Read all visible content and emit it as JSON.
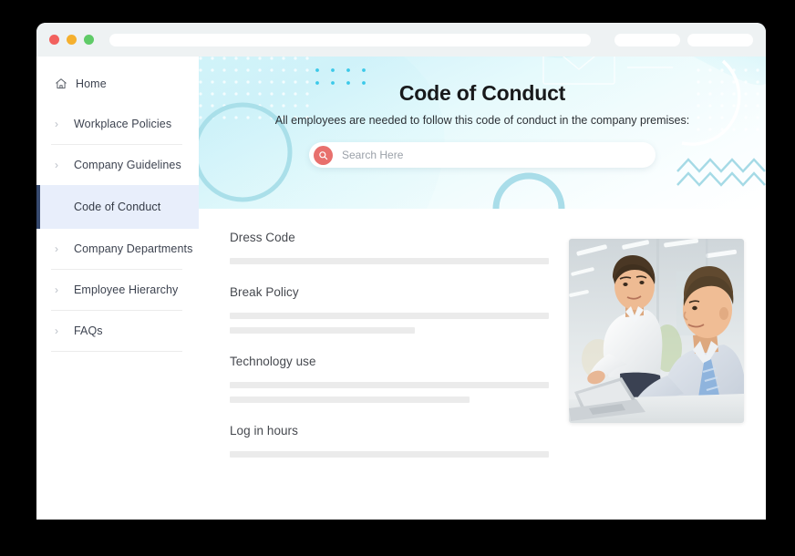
{
  "browser": {
    "traffic_lights": [
      "close",
      "minimize",
      "maximize"
    ],
    "address_bar_value": "",
    "tab_placeholders": 2
  },
  "sidebar": {
    "items": [
      {
        "label": "Home",
        "icon": "home-icon",
        "expandable": false,
        "active": false,
        "divider_after": false
      },
      {
        "label": "Workplace Policies",
        "icon": "chevron-right-icon",
        "expandable": true,
        "active": false,
        "divider_after": true
      },
      {
        "label": "Company Guidelines",
        "icon": "chevron-right-icon",
        "expandable": true,
        "active": false,
        "divider_after": false
      },
      {
        "label": "Code of Conduct",
        "icon": "",
        "expandable": false,
        "active": true,
        "divider_after": false
      },
      {
        "label": "Company Departments",
        "icon": "chevron-right-icon",
        "expandable": true,
        "active": false,
        "divider_after": true
      },
      {
        "label": "Employee Hierarchy",
        "icon": "chevron-right-icon",
        "expandable": true,
        "active": false,
        "divider_after": true
      },
      {
        "label": "FAQs",
        "icon": "chevron-right-icon",
        "expandable": true,
        "active": false,
        "divider_after": true
      }
    ]
  },
  "hero": {
    "title": "Code of Conduct",
    "subtitle": "All employees are needed to follow this code of conduct in the company premises:",
    "search": {
      "placeholder": "Search Here",
      "value": "",
      "icon": "search-icon",
      "icon_color": "#e8706d"
    }
  },
  "content": {
    "sections": [
      {
        "title": "Dress Code",
        "bars": [
          100
        ]
      },
      {
        "title": "Break Policy",
        "bars": [
          100,
          58
        ]
      },
      {
        "title": "Technology use",
        "bars": [
          100,
          75
        ]
      },
      {
        "title": "Log in hours",
        "bars": [
          100
        ]
      }
    ],
    "image": {
      "alt": "Two businessmen discussing over a laptop in an office",
      "name": "office-discussion-photo"
    }
  },
  "colors": {
    "accent_navy": "#36496e",
    "active_bg": "#e8eefb",
    "search_accent": "#e8706d",
    "hero_teal": "#a9dfe8"
  }
}
